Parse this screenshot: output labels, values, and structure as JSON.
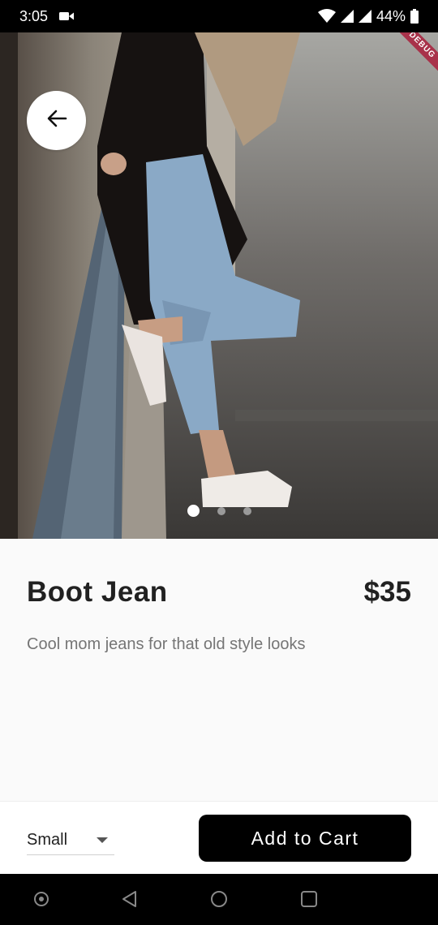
{
  "status_bar": {
    "time": "3:05",
    "battery": "44%",
    "icons": [
      "video-camera-icon",
      "wifi-icon",
      "signal-icon",
      "signal-icon-2",
      "battery-icon"
    ]
  },
  "hero": {
    "debug_banner": "DEBUG",
    "page_count": 3,
    "current_page": 1
  },
  "product": {
    "title": "Boot Jean",
    "price": "$35",
    "description": "Cool mom jeans for that old style looks"
  },
  "actions": {
    "size_selected": "Small",
    "add_to_cart_label": "Add to Cart"
  },
  "navigation": {
    "icons": [
      "assistant-icon",
      "back-triangle-icon",
      "home-circle-icon",
      "recents-square-icon"
    ]
  },
  "colors": {
    "button": "#000000",
    "background": "#fafafa",
    "debug_banner": "#a8324a"
  }
}
